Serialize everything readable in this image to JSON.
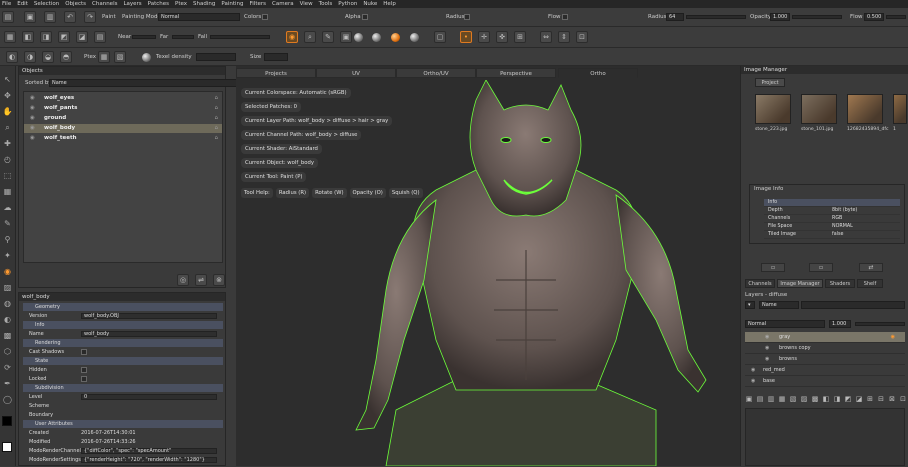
{
  "menu": [
    "File",
    "Edit",
    "Selection",
    "Objects",
    "Channels",
    "Layers",
    "Patches",
    "Ptex",
    "Shading",
    "Painting",
    "Filters",
    "Camera",
    "View",
    "Tools",
    "Python",
    "Nuke",
    "Help"
  ],
  "toolbar1": {
    "paint_label": "Paint",
    "painting_mode_label": "Painting Mode",
    "painting_mode_value": "Normal",
    "colors_label": "Colors",
    "alpha_label": "Alpha",
    "radius_label": "Radius",
    "flow_label": "Flow",
    "radius2_label": "Radius",
    "radius2_value": "64",
    "opacity_label": "Opacity",
    "opacity_value": "1.000",
    "flow2_label": "Flow",
    "flow2_value": "0.500"
  },
  "toolbar2": {
    "near_label": "Near",
    "far_label": "Far",
    "fall_label": "Fall"
  },
  "toolbar3": {
    "ptex_label": "Ptex",
    "texel_density_label": "Texel density",
    "size_label": "Size"
  },
  "objects_panel": {
    "title": "Objects",
    "sorted_by_label": "Sorted by",
    "sorted_by_value": "Name",
    "items": [
      "wolf_eyes",
      "wolf_pants",
      "ground",
      "wolf_body",
      "wolf_teeth"
    ],
    "selected_index": 3
  },
  "properties_panel": {
    "title": "wolf_body",
    "rows": [
      {
        "type": "hdr",
        "label": "Geometry"
      },
      {
        "type": "val",
        "label": "Version",
        "value": "wolf_body.OBJ"
      },
      {
        "type": "hdr",
        "label": "Info"
      },
      {
        "type": "val",
        "label": "Name",
        "value": "wolf_body"
      },
      {
        "type": "hdr",
        "label": "Rendering"
      },
      {
        "type": "chk",
        "label": "Cast Shadows"
      },
      {
        "type": "hdr",
        "label": "State"
      },
      {
        "type": "chk",
        "label": "Hidden"
      },
      {
        "type": "chk",
        "label": "Locked"
      },
      {
        "type": "hdr",
        "label": "Subdivision"
      },
      {
        "type": "val",
        "label": "Level",
        "value": "0"
      },
      {
        "type": "txt",
        "label": "Scheme"
      },
      {
        "type": "txt",
        "label": "Boundary"
      },
      {
        "type": "hdr",
        "label": "User Attributes"
      },
      {
        "type": "txt",
        "label": "Created",
        "value": "2016-07-26T14:30:01"
      },
      {
        "type": "txt",
        "label": "Modified",
        "value": "2016-07-26T14:33:26"
      },
      {
        "type": "val",
        "label": "ModoRenderChannelAssignments",
        "value": "{\"diffColor\", \"spec\": \"specAmount\""
      },
      {
        "type": "val",
        "label": "ModoRenderSettings",
        "value": "{\"renderHeight\": \"720\", \"renderWidth\": \"1280\"}"
      }
    ]
  },
  "viewport": {
    "tabs": [
      "Projects",
      "UV",
      "Ortho/UV",
      "Perspective",
      "Ortho"
    ],
    "active_tab": 4,
    "info": [
      "Current Colorspace: Automatic (sRGB)",
      "Selected Patches: 0",
      "Current Layer Path: wolf_body > diffuse > hair > gray",
      "Current Channel Path: wolf_body > diffuse",
      "Current Shader: AiStandard",
      "Current Object: wolf_body",
      "Current Tool: Paint (P)"
    ],
    "tool_help": [
      "Tool Help:",
      "Radius (R)",
      "Rotate (W)",
      "Opacity (O)",
      "Squish (Q)"
    ]
  },
  "image_manager": {
    "title": "Image Manager",
    "tab": "Project",
    "images": [
      {
        "caption": "stone_223.jpg",
        "color": "#8a7a66"
      },
      {
        "caption": "stone_101.jpg",
        "color": "#7c6e5e"
      },
      {
        "caption": "12682435894_dfc",
        "color": "#a07850"
      },
      {
        "caption": "1",
        "color": "#8e6a44"
      }
    ],
    "info_title": "Image Info",
    "info_header": "Info",
    "info_rows": [
      {
        "label": "Depth",
        "value": "8bit (byte)"
      },
      {
        "label": "Channels",
        "value": "RGB"
      },
      {
        "label": "File Space",
        "value": "NORMAL"
      },
      {
        "label": "Tiled Image",
        "value": "false"
      }
    ]
  },
  "layers_panel": {
    "tabs": [
      "Channels",
      "Image Manager",
      "Shaders",
      "Shelf"
    ],
    "active_tab": 1,
    "title": "Layers - diffuse",
    "name_value": "Name",
    "blend_value": "Normal",
    "opacity_value": "1.000",
    "layers": [
      {
        "name": "gray",
        "selected": true,
        "indent": 1
      },
      {
        "name": "browns copy",
        "selected": false,
        "indent": 1
      },
      {
        "name": "browns",
        "selected": false,
        "indent": 1
      },
      {
        "name": "red_med",
        "selected": false,
        "indent": 0
      },
      {
        "name": "base",
        "selected": false,
        "indent": 0
      }
    ]
  },
  "colors": {
    "accent": "#e07a20",
    "highlight_green": "#6cff3a"
  }
}
